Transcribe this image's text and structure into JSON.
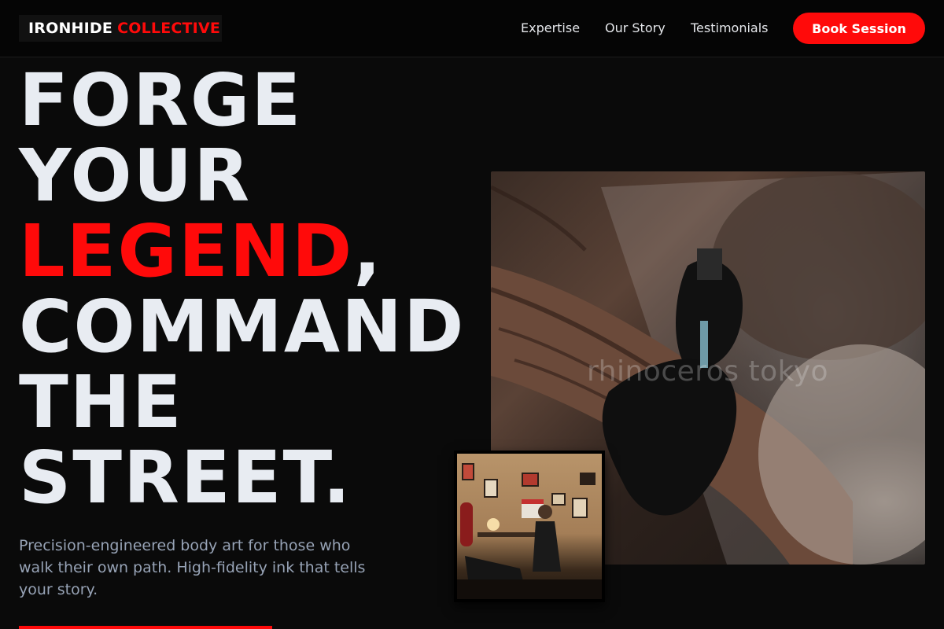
{
  "header": {
    "logo_word1": "IRONHIDE",
    "logo_word2": "COLLECTIVE",
    "nav": [
      {
        "label": "Expertise"
      },
      {
        "label": "Our Story"
      },
      {
        "label": "Testimonials"
      }
    ],
    "cta_label": "Book Session"
  },
  "hero": {
    "line1": "FORGE",
    "line2": "YOUR",
    "line3_accent": "LEGEND",
    "line3_suffix": ",",
    "line4": "COMMAND",
    "line5": "THE",
    "line6": "STREET.",
    "tagline": "Precision-engineered body art for those who walk their own path. High-fidelity ink that tells your story."
  },
  "media": {
    "main_photo_watermark": "rhinoceros tokyo"
  },
  "colors": {
    "accent": "#ff0a0a",
    "background": "#0a0a0a",
    "headline": "#e8ecf2",
    "tagline": "#97a3b6"
  }
}
